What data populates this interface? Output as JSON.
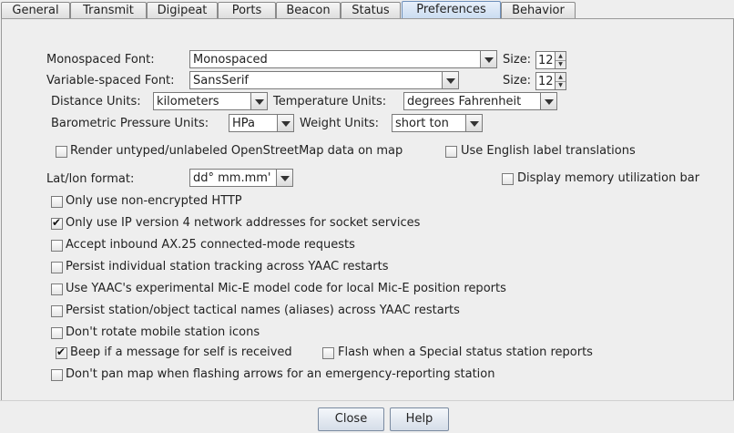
{
  "tabs": [
    {
      "label": "General"
    },
    {
      "label": "Transmit"
    },
    {
      "label": "Digipeat"
    },
    {
      "label": "Ports"
    },
    {
      "label": "Beacon"
    },
    {
      "label": "Status"
    },
    {
      "label": "Preferences"
    },
    {
      "label": "Behavior"
    }
  ],
  "fonts": {
    "mono_label": "Monospaced Font:",
    "mono_value": "Monospaced",
    "mono_size_label": "Size:",
    "mono_size": "12",
    "var_label": "Variable-spaced Font:",
    "var_value": "SansSerif",
    "var_size_label": "Size:",
    "var_size": "12"
  },
  "units": {
    "distance_label": "Distance Units:",
    "distance_value": "kilometers",
    "temperature_label": "Temperature Units:",
    "temperature_value": "degrees Fahrenheit",
    "pressure_label": "Barometric Pressure Units:",
    "pressure_value": "HPa",
    "weight_label": "Weight Units:",
    "weight_value": "short ton"
  },
  "map_options": {
    "render_untyped": "Render untyped/unlabeled OpenStreetMap data on map",
    "english_labels": "Use English label translations"
  },
  "latlon": {
    "label": "Lat/lon format:",
    "value": "dd° mm.mm'",
    "memory_bar": "Display memory utilization bar"
  },
  "options": {
    "non_encrypted_http": "Only use non-encrypted HTTP",
    "ipv4_only": "Only use IP version 4 network addresses for socket services",
    "ax25_inbound": "Accept inbound AX.25 connected-mode requests",
    "persist_tracking": "Persist individual station tracking across YAAC restarts",
    "experimental_mice": "Use YAAC's experimental Mic-E model code for local Mic-E position reports",
    "persist_tactical": "Persist station/object tactical names (aliases) across YAAC restarts",
    "no_rotate_icons": "Don't rotate mobile station icons",
    "beep_message": "Beep if a message for self is received",
    "flash_special": "Flash when a Special status station reports",
    "no_pan_emergency": "Don't pan map when flashing arrows for an emergency-reporting station"
  },
  "buttons": {
    "close": "Close",
    "help": "Help"
  },
  "check_mark": "✔"
}
